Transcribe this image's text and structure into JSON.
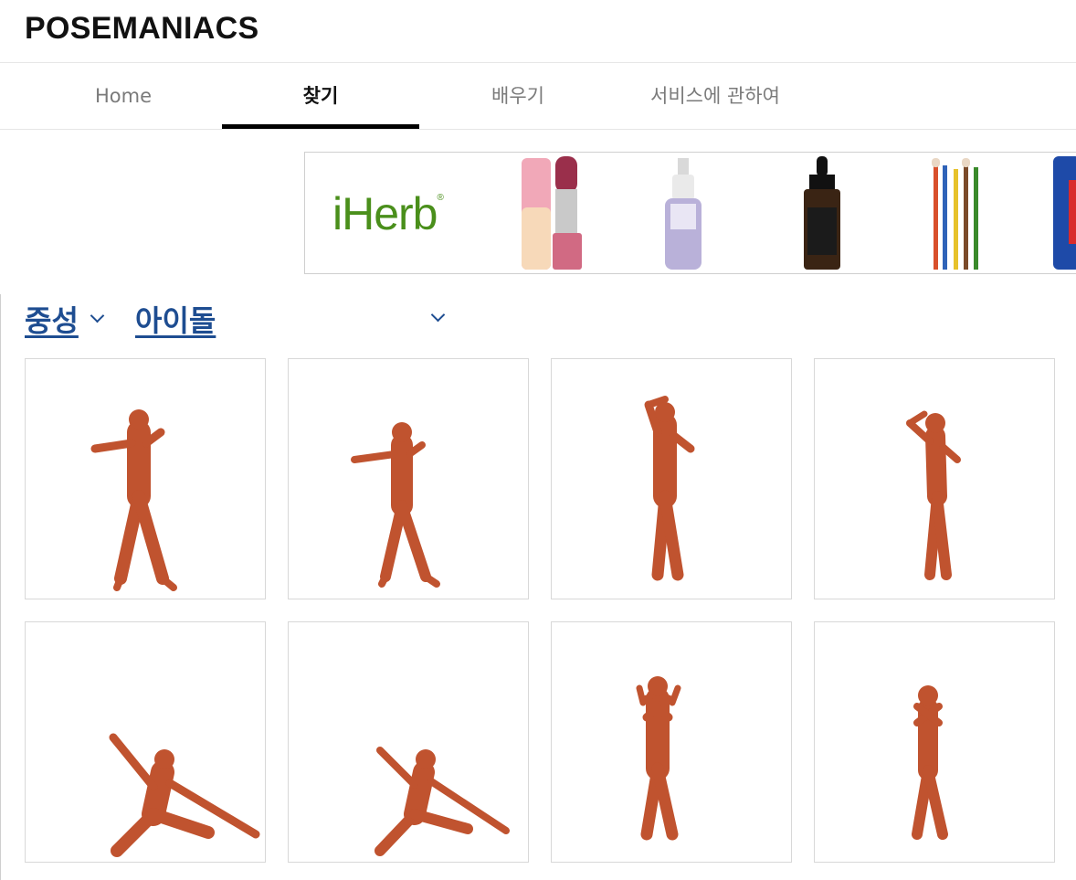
{
  "header": {
    "brand": "POSEMANIACS"
  },
  "nav": {
    "tabs": [
      {
        "label": "Home",
        "active": false
      },
      {
        "label": "찾기",
        "active": true
      },
      {
        "label": "배우기",
        "active": false
      },
      {
        "label": "서비스에 관하여",
        "active": false
      }
    ]
  },
  "ad": {
    "logo": "iHerb",
    "products": [
      "lipstick",
      "serum-dropper-bottle",
      "amber-dropper-bottle",
      "makeup-brushes",
      "lip-balm"
    ]
  },
  "filters": {
    "gender": "중성",
    "category": "아이돌"
  },
  "colors": {
    "accent_link": "#1e4d91",
    "iherb_green": "#4a8f1b",
    "muscle": "#c0532f"
  },
  "grid": {
    "items": [
      {
        "pose": "arm-extended-left-wide-stance"
      },
      {
        "pose": "arm-extended-left-wide-stance-female"
      },
      {
        "pose": "hand-behind-head-standing"
      },
      {
        "pose": "hand-on-head-standing-female"
      },
      {
        "pose": "low-lunge-arm-raised"
      },
      {
        "pose": "low-lunge-arm-raised-female"
      },
      {
        "pose": "arms-crossed-chest-standing"
      },
      {
        "pose": "arms-crossed-chest-standing-female"
      }
    ]
  }
}
